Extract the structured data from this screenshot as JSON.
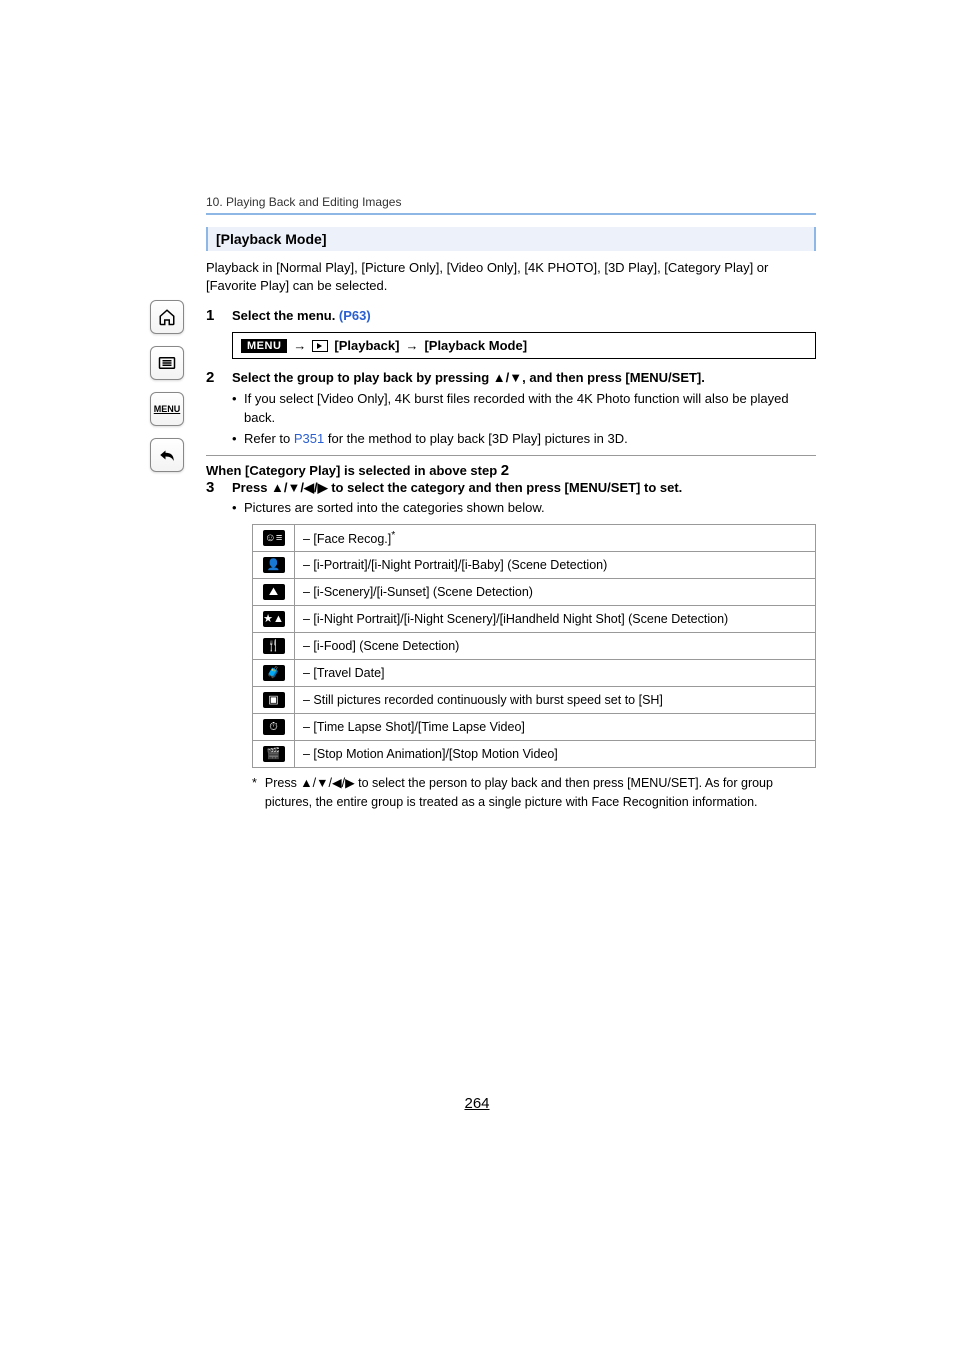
{
  "breadcrumb": "10. Playing Back and Editing Images",
  "sectionTitle": "[Playback Mode]",
  "introPara": "Playback in [Normal Play], [Picture Only], [Video Only], [4K PHOTO], [3D Play], [Category Play] or [Favorite Play] can be selected.",
  "steps": {
    "s1": {
      "num": "1",
      "text": "Select the menu. ",
      "link": "(P63)"
    },
    "menuPath": {
      "badge": "MENU",
      "arrow1": "→",
      "part1": "[Playback]",
      "arrow2": "→",
      "part2": "[Playback Mode]"
    },
    "s2": {
      "num": "2",
      "heading": "Select the group to play back by pressing ▲/▼, and then press [MENU/SET].",
      "b1": "If you select [Video Only], 4K burst files recorded with the 4K Photo function will also be played back.",
      "b2a": "Refer to ",
      "b2link": "P351",
      "b2b": " for the method to play back [3D Play] pictures in 3D."
    },
    "subhead": "When [Category Play] is selected in above step ",
    "subheadNum": "2",
    "s3": {
      "num": "3",
      "heading": "Press ▲/▼/◀/▶ to select the category and then press [MENU/SET] to set.",
      "b1": "Pictures are sorted into the categories shown below."
    }
  },
  "categories": [
    {
      "icon": "face",
      "text": "– [Face Recog.]",
      "sup": "*"
    },
    {
      "icon": "portrait",
      "text": "– [i-Portrait]/[i-Night Portrait]/[i-Baby] (Scene Detection)"
    },
    {
      "icon": "scenery",
      "text": "– [i-Scenery]/[i-Sunset] (Scene Detection)"
    },
    {
      "icon": "night",
      "text": "– [i-Night Portrait]/[i-Night Scenery]/[iHandheld Night Shot] (Scene Detection)"
    },
    {
      "icon": "food",
      "text": "– [i-Food] (Scene Detection)"
    },
    {
      "icon": "travel",
      "text": "– [Travel Date]"
    },
    {
      "icon": "burst",
      "text": "– Still pictures recorded continuously with burst speed set to [SH]"
    },
    {
      "icon": "timelapse",
      "text": "– [Time Lapse Shot]/[Time Lapse Video]"
    },
    {
      "icon": "stopmotion",
      "text": "– [Stop Motion Animation]/[Stop Motion Video]"
    }
  ],
  "footnote": {
    "mark": "*",
    "text": "Press ▲/▼/◀/▶ to select the person to play back and then press [MENU/SET]. As for group pictures, the entire group is treated as a single picture with Face Recognition information."
  },
  "pageNumber": "264",
  "sideLabels": {
    "menu": "MENU"
  }
}
